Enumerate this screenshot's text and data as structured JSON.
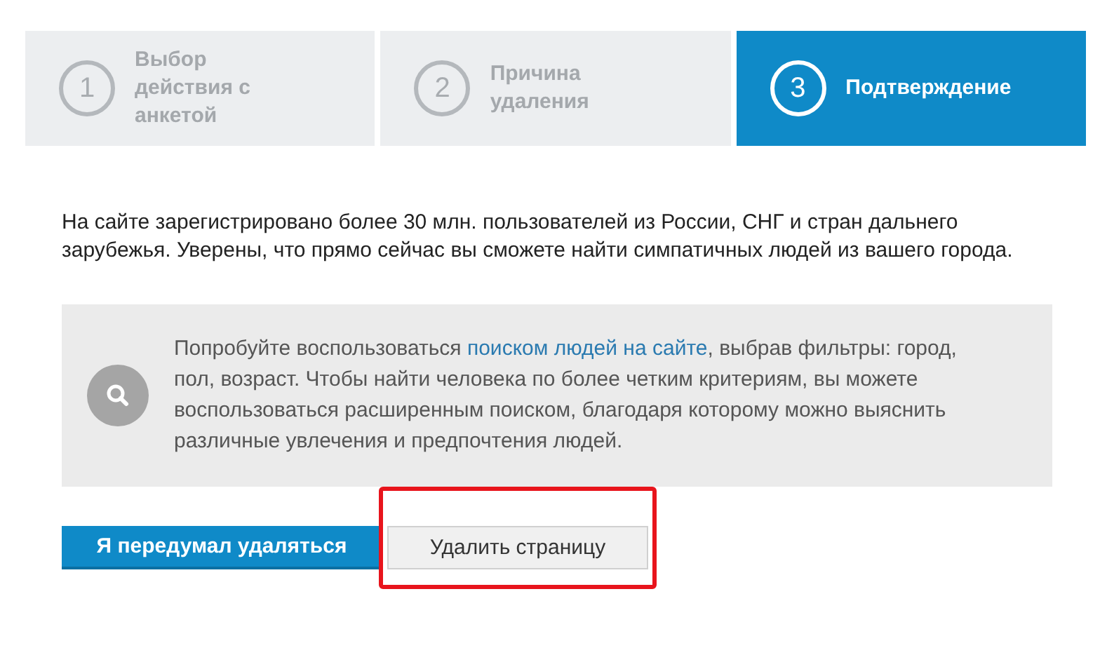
{
  "steps": [
    {
      "number": "1",
      "label": "Выбор действия с анкетой",
      "selected": false
    },
    {
      "number": "2",
      "label": "Причина удаления",
      "selected": false
    },
    {
      "number": "3",
      "label": "Подтверждение",
      "selected": true
    }
  ],
  "intro": "На сайте зарегистрировано более 30 млн. пользователей из России, СНГ и стран дальнего зарубежья. Уверены, что прямо сейчас вы сможете найти симпатичных людей из вашего города.",
  "tip": {
    "before": "Попробуйте воспользоваться ",
    "link": "поиском людей на сайте",
    "after": ", выбрав фильтры: город, пол, возраст. Чтобы найти человека по более четким критериям, вы можете воспользоваться расширенным поиском, благодаря которому можно выяснить различные увлечения и предпочтения людей."
  },
  "buttons": [
    {
      "label": "Я передумал удаляться",
      "kind": "primary",
      "highlighted": false
    },
    {
      "label": "Удалить страницу",
      "kind": "secondary",
      "highlighted": true
    }
  ]
}
